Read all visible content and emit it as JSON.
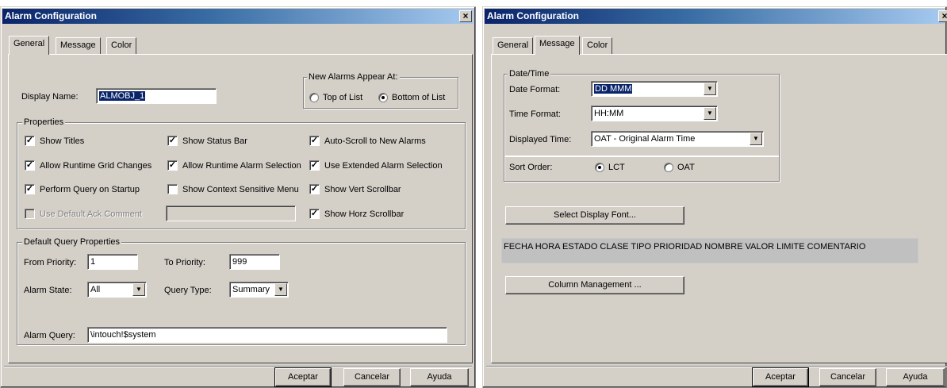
{
  "left": {
    "title": "Alarm Configuration",
    "close_glyph": "×",
    "tabs": [
      "General",
      "Message",
      "Color"
    ],
    "display_name_label": "Display Name:",
    "display_name_value": "ALMOBJ_1",
    "new_alarms_group": "New Alarms Appear At:",
    "radio_top": "Top of List",
    "radio_bottom": "Bottom of List",
    "properties_group": "Properties",
    "checks": {
      "show_titles": "Show Titles",
      "show_status_bar": "Show Status Bar",
      "auto_scroll": "Auto-Scroll to New Alarms",
      "allow_grid": "Allow Runtime Grid Changes",
      "allow_alarm_sel": "Allow Runtime Alarm Selection",
      "use_extended": "Use Extended Alarm Selection",
      "perform_query": "Perform Query on Startup",
      "show_context": "Show Context Sensitive Menu",
      "show_vert": "Show Vert Scrollbar",
      "use_default_ack": "Use Default Ack Comment",
      "show_horz": "Show Horz Scrollbar"
    },
    "check_mark": "✓",
    "query_group": "Default Query Properties",
    "from_priority_label": "From Priority:",
    "from_priority_value": "1",
    "to_priority_label": "To Priority:",
    "to_priority_value": "999",
    "alarm_state_label": "Alarm State:",
    "alarm_state_value": "All",
    "query_type_label": "Query Type:",
    "query_type_value": "Summary",
    "alarm_query_label": "Alarm Query:",
    "alarm_query_value": "\\intouch!$system",
    "buttons": {
      "ok": "Aceptar",
      "cancel": "Cancelar",
      "help": "Ayuda"
    }
  },
  "right": {
    "title": "Alarm Configuration",
    "close_glyph": "×",
    "tabs": [
      "General",
      "Message",
      "Color"
    ],
    "datetime_group": "Date/Time",
    "date_format_label": "Date Format:",
    "date_format_value": "DD MMM",
    "time_format_label": "Time Format:",
    "time_format_value": "HH:MM",
    "displayed_time_label": "Displayed Time:",
    "displayed_time_value": "OAT - Original Alarm Time",
    "sort_order_label": "Sort Order:",
    "sort_lct": "LCT",
    "sort_oat": "OAT",
    "select_font_button": "Select Display Font...",
    "columns_text": "FECHA HORA ESTADO CLASE TIPO PRIORIDAD NOMBRE VALOR LIMITE COMENTARIO",
    "column_mgmt_button": "Column Management ...",
    "buttons": {
      "ok": "Aceptar",
      "cancel": "Cancelar",
      "help": "Ayuda"
    }
  },
  "icons": {
    "dropdown": "▼"
  },
  "colors": {
    "title_bar": "#0a246a",
    "face": "#d4d0c8",
    "selection": "#0a246a"
  }
}
